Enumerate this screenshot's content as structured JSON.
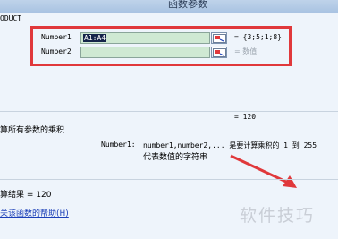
{
  "dialog": {
    "title": "函数参数"
  },
  "function_name": "ODUCT",
  "args": [
    {
      "name": "Number1",
      "input": "A1:A4",
      "result": "= {3;5;1;8}"
    },
    {
      "name": "Number2",
      "input": "",
      "result": "= 数值"
    }
  ],
  "formula_result": "= 120",
  "description": "算所有参数的乘积",
  "param_help_label": "Number1:",
  "param_help_line1": "number1,number2,... 是要计算乘积的 1 到 255",
  "param_help_line2": "代表数值的字符串",
  "calc_result": "算结果 = 120",
  "help_link": "关该函数的帮助(H)",
  "watermark": "软件技巧",
  "colors": {
    "highlight_box": "#e0383b",
    "input_bg": "#cfe9d3",
    "link": "#1b3fb8"
  }
}
